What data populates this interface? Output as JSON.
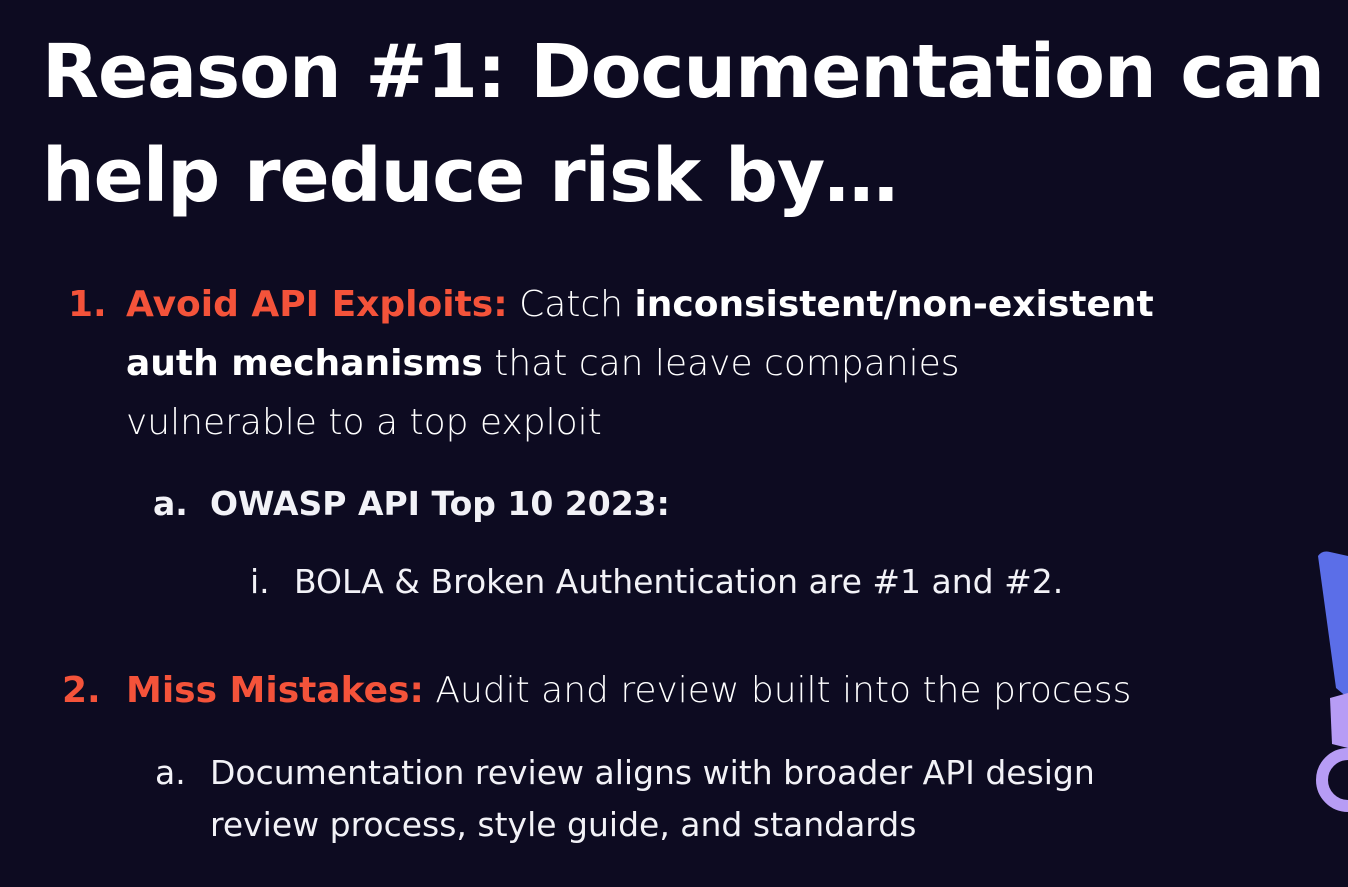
{
  "slide": {
    "title": "Reason #1: Documentation can help reduce risk by…",
    "items": [
      {
        "marker": "1.",
        "lead": "Avoid API Exploits:",
        "text_1": " Catch ",
        "bold_1": "inconsistent/non-existent",
        "bold_2": "auth mechanisms",
        "text_2": " that can leave companies",
        "text_3": "vulnerable to a top exploit",
        "sub": {
          "marker": "a.",
          "lead": "OWASP API Top 10 2023:",
          "subsub": {
            "marker": "i.",
            "text": "BOLA & Broken Authentication are #1 and #2."
          }
        }
      },
      {
        "marker": "2.",
        "lead": "Miss Mistakes:",
        "text_1": " Audit and review built into the process",
        "sub": {
          "marker": "a.",
          "text_1": "Documentation review aligns with broader API design",
          "text_2": "review process, style guide, and standards"
        }
      }
    ]
  },
  "colors": {
    "background": "#0d0b21",
    "accent_red": "#f4533a",
    "accent_purple": "#a79cf2",
    "decoration_blue": "#5b6ee8",
    "decoration_violet": "#b79cf5"
  }
}
